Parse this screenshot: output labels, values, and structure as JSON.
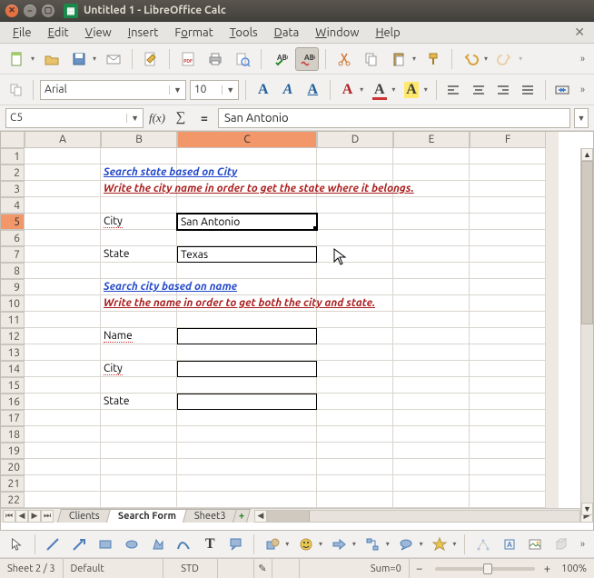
{
  "window": {
    "title": "Untitled 1 - LibreOffice Calc"
  },
  "menu": {
    "file": "File",
    "edit": "Edit",
    "view": "View",
    "insert": "Insert",
    "format": "Format",
    "tools": "Tools",
    "data": "Data",
    "window": "Window",
    "help": "Help"
  },
  "format_toolbar": {
    "font": "Arial",
    "size": "10"
  },
  "formula": {
    "cellref": "C5",
    "value": "San Antonio"
  },
  "columns": [
    "A",
    "B",
    "C",
    "D",
    "E",
    "F"
  ],
  "rows_visible": 22,
  "cells": {
    "B2": {
      "text": "Search state based on City",
      "cls": "blue-link"
    },
    "B3": {
      "text": "Write the city name in order to get the state where it belongs.",
      "cls": "red-text"
    },
    "B5": {
      "text": "City",
      "cls": "redsquiggle"
    },
    "C5": {
      "text": "San Antonio",
      "box": true,
      "selected": true
    },
    "B7": {
      "text": "State"
    },
    "C7": {
      "text": "Texas",
      "box": true
    },
    "B9": {
      "text": "Search city based on name",
      "cls": "blue-link"
    },
    "B10": {
      "text": "Write the name in order to get both the city and state.",
      "cls": "red-text"
    },
    "B12": {
      "text": "Name",
      "cls": "redsquiggle"
    },
    "C12": {
      "text": "",
      "box": true
    },
    "B14": {
      "text": "City",
      "cls": "redsquiggle"
    },
    "C14": {
      "text": "",
      "box": true
    },
    "B16": {
      "text": "State"
    },
    "C16": {
      "text": "",
      "box": true
    }
  },
  "tabs": {
    "items": [
      "Clients",
      "Search Form",
      "Sheet3"
    ],
    "active": 1
  },
  "status": {
    "sheet": "Sheet 2 / 3",
    "style": "Default",
    "mode": "STD",
    "sum": "Sum=0",
    "zoom": "100%"
  },
  "icons": {
    "std": [
      "new",
      "open",
      "save",
      "email",
      "edit",
      "pdf",
      "print",
      "preview",
      "spellcheck",
      "autospell",
      "cut",
      "copy",
      "paste",
      "clone",
      "undo",
      "redo"
    ],
    "fmt": [
      "bold",
      "italic",
      "underline",
      "color-blue",
      "color-red",
      "color-red-ul",
      "bg-red",
      "bg-yellow",
      "align-l",
      "align-c",
      "align-r",
      "align-j",
      "merge"
    ],
    "fbar": [
      "fx",
      "sum",
      "eq"
    ],
    "draw": [
      "pointer",
      "line",
      "arrowline",
      "rect",
      "ellipse",
      "polygon",
      "curve",
      "text",
      "callout",
      "shapes",
      "symbol",
      "arrows",
      "flow",
      "callouts",
      "stars",
      "points",
      "fontwork",
      "image",
      "extrude"
    ]
  }
}
